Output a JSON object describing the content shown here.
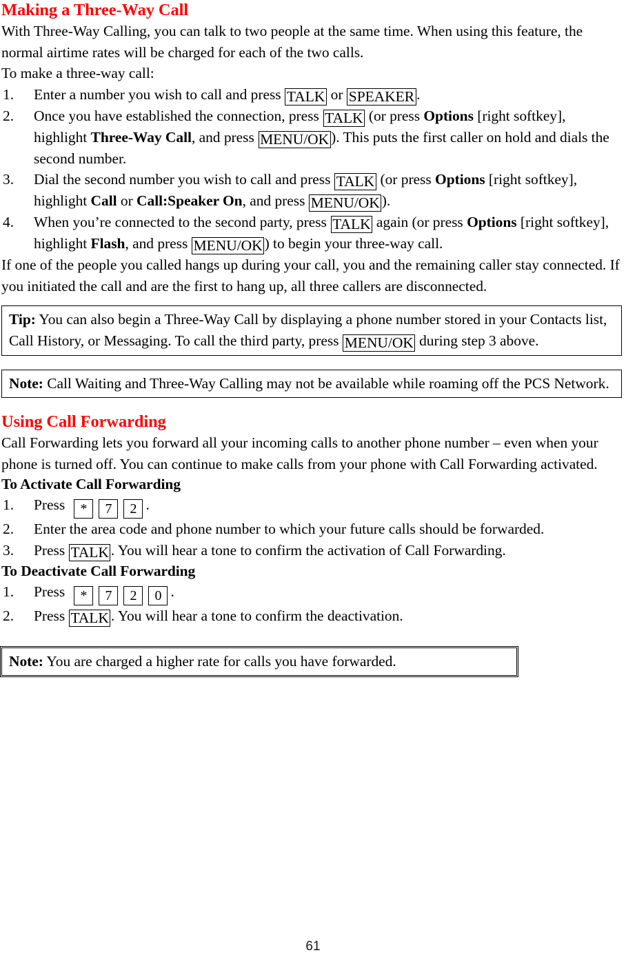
{
  "document": {
    "page_number": "61",
    "heading_color": "#ff0000"
  },
  "section_three_way": {
    "heading": "Making a Three-Way Call",
    "intro": "With Three-Way Calling, you can talk to two people at the same time. When using this feature, the normal airtime rates will be charged for each of the two calls.",
    "lead_in": "To make a three-way call:",
    "steps": [
      {
        "num": "1.",
        "p1": "Enter a number you wish to call and press ",
        "key1": "TALK",
        "p2": " or ",
        "key2": "SPEAKER",
        "p3": "."
      },
      {
        "num": "2.",
        "p1": "Once you have established the connection, press ",
        "key1": "TALK",
        "p2": " (or press ",
        "b1": "Options",
        "p3": " [right softkey], highlight ",
        "b2": "Three-Way Call",
        "p4": ", and press ",
        "key2": "MENU/OK",
        "p5": "). This puts the first caller on hold and dials the second number."
      },
      {
        "num": "3.",
        "p1": "Dial the second number you wish to call and press ",
        "key1": "TALK",
        "p2": " (or press ",
        "b1": "Options",
        "p3": " [right softkey], highlight ",
        "b2": "Call",
        "p4": " or ",
        "b3": "Call:Speaker On",
        "p5": ", and press ",
        "key2": "MENU/OK",
        "p6": ")."
      },
      {
        "num": "4.",
        "p1": "When you’re connected to the second party, press ",
        "key1": "TALK",
        "p2": " again (or press ",
        "b1": "Options",
        "p3": " [right softkey], highlight ",
        "b2": "Flash",
        "p4": ", and press ",
        "key2": "MENU/OK",
        "p5": ") to begin your three-way call."
      }
    ],
    "outro": "If one of the people you called hangs up during your call, you and the remaining caller stay connected. If you initiated the call and are the first to hang up, all three callers are disconnected.",
    "tip_box": {
      "label": "Tip:",
      "p1": " You can also begin a Three-Way Call by displaying a phone number stored in your Contacts list, Call History, or Messaging. To call the third party, press ",
      "key1": "MENU/OK",
      "p2": " during step 3 above."
    },
    "note_box": {
      "label": "Note:",
      "p1": " Call Waiting and Three-Way Calling may not be available while roaming off the PCS Network."
    }
  },
  "section_call_forwarding": {
    "heading": "Using Call Forwarding",
    "intro": "Call Forwarding lets you forward all your incoming calls to another phone number – even when your phone is turned off. You can continue to make calls from your phone with Call Forwarding activated.",
    "activate": {
      "subheading": "To Activate Call Forwarding",
      "steps": [
        {
          "num": "1.",
          "p1": "Press ",
          "keypad": [
            "*",
            "7",
            "2"
          ],
          "p2": "."
        },
        {
          "num": "2.",
          "p1": "Enter the area code and phone number to which your future calls should be forwarded."
        },
        {
          "num": "3.",
          "p1": "Press ",
          "key1": "TALK",
          "p2": ". You will hear a tone to confirm the activation of Call Forwarding."
        }
      ]
    },
    "deactivate": {
      "subheading": "To Deactivate Call Forwarding",
      "steps": [
        {
          "num": "1.",
          "p1": "Press ",
          "keypad": [
            "*",
            "7",
            "2",
            "0"
          ],
          "p2": "."
        },
        {
          "num": "2.",
          "p1": "Press ",
          "key1": "TALK",
          "p2": ". You will hear a tone to confirm the deactivation."
        }
      ]
    },
    "note_box": {
      "label": "Note:",
      "p1": " You are charged a higher rate for calls you have forwarded."
    }
  }
}
